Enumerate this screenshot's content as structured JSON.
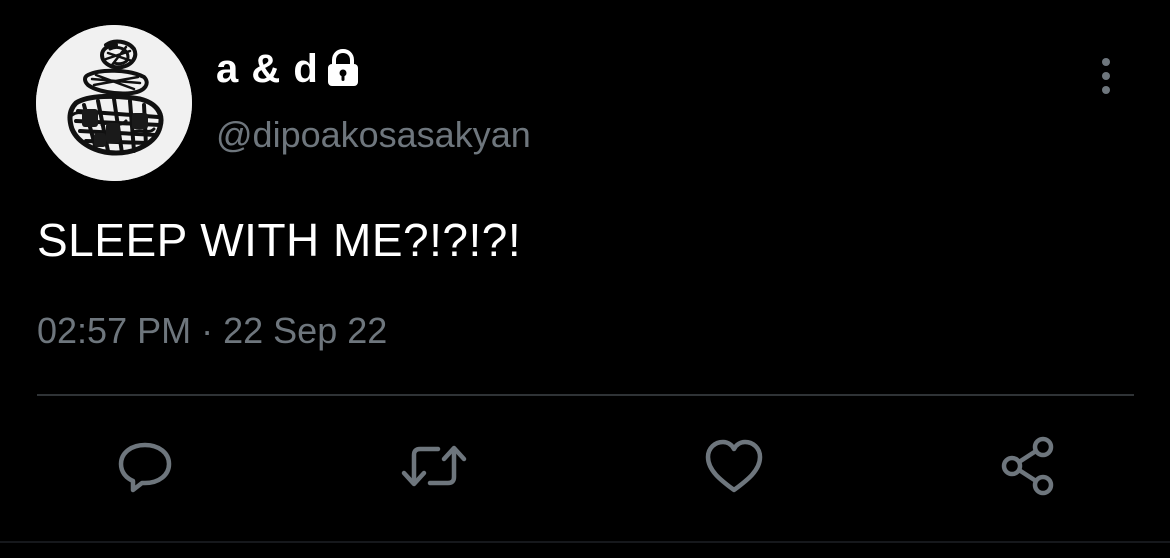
{
  "user": {
    "display_name": "a & d",
    "handle": "@dipoakosasakyan",
    "protected": true,
    "avatar": "abstract-scribble-avatar"
  },
  "tweet": {
    "text": "SLEEP WITH ME?!?!?!",
    "time": "02:57 PM",
    "separator": "·",
    "date": "22 Sep 22"
  },
  "actions": [
    {
      "name": "reply",
      "icon": "comment-bubble-icon"
    },
    {
      "name": "retweet",
      "icon": "retweet-icon"
    },
    {
      "name": "like",
      "icon": "heart-icon"
    },
    {
      "name": "share",
      "icon": "share-icon"
    }
  ],
  "colors": {
    "background": "#000000",
    "primary_text": "#ffffff",
    "secondary_text": "#6e767d",
    "divider": "#2f3336"
  }
}
